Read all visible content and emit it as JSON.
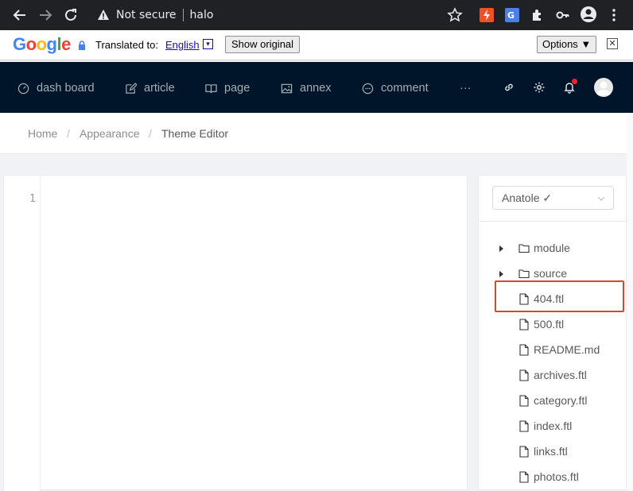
{
  "browser": {
    "security_label": "Not secure",
    "url": "halo"
  },
  "translate_bar": {
    "logo_text": "Google",
    "translated_to_label": "Translated to:",
    "language": "English",
    "language_dropdown": "▾",
    "show_original_label": "Show original",
    "options_label": "Options ▼",
    "close_label": "✕"
  },
  "nav": {
    "items": [
      {
        "label": "dash board",
        "icon": "dashboard-icon"
      },
      {
        "label": "article",
        "icon": "edit-icon"
      },
      {
        "label": "page",
        "icon": "book-icon"
      },
      {
        "label": "annex",
        "icon": "image-icon"
      },
      {
        "label": "comment",
        "icon": "comment-icon"
      },
      {
        "label": "···",
        "icon": "more-icon"
      }
    ]
  },
  "breadcrumb": {
    "items": [
      "Home",
      "Appearance",
      "Theme Editor"
    ],
    "separator": "/"
  },
  "editor": {
    "line_numbers": [
      "1"
    ]
  },
  "theme_select": {
    "value": "Anatole ✓"
  },
  "file_tree": {
    "items": [
      {
        "label": "module",
        "type": "folder"
      },
      {
        "label": "source",
        "type": "folder"
      },
      {
        "label": "404.ftl",
        "type": "file",
        "selected": true
      },
      {
        "label": "500.ftl",
        "type": "file"
      },
      {
        "label": "README.md",
        "type": "file"
      },
      {
        "label": "archives.ftl",
        "type": "file"
      },
      {
        "label": "category.ftl",
        "type": "file"
      },
      {
        "label": "index.ftl",
        "type": "file"
      },
      {
        "label": "links.ftl",
        "type": "file"
      },
      {
        "label": "photos.ftl",
        "type": "file"
      }
    ]
  },
  "colors": {
    "nav_background": "#00152a",
    "highlight": "#d9462a",
    "notification_dot": "#f5222d"
  }
}
